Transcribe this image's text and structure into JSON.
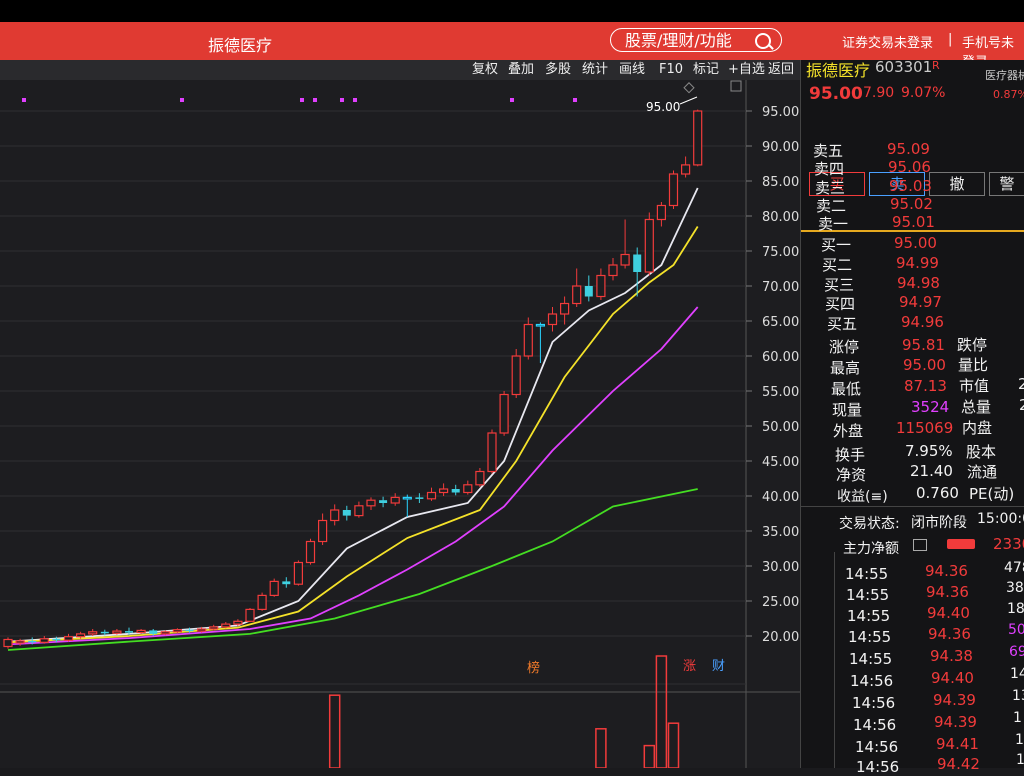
{
  "header": {
    "title": "振德医疗",
    "search_label": "股票/理财/功能",
    "login_status": "证券交易未登录",
    "phone_status": "手机号未登录"
  },
  "toolbar": [
    "复权",
    "叠加",
    "多股",
    "统计",
    "画线",
    "F10",
    "标记",
    "+自选",
    "返回"
  ],
  "stock": {
    "name": "振德医疗",
    "code": "603301",
    "r_flag": "R",
    "price": "95.00",
    "change": "7.90",
    "pct": "9.07%",
    "sector": "医疗器械",
    "sector_pct": "0.87%"
  },
  "trade_buttons": [
    "买",
    "卖",
    "撤",
    "警"
  ],
  "orderbook": {
    "asks": [
      {
        "label": "卖五",
        "price": "95.09"
      },
      {
        "label": "卖四",
        "price": "95.06"
      },
      {
        "label": "卖三",
        "price": "95.03"
      },
      {
        "label": "卖二",
        "price": "95.02"
      },
      {
        "label": "卖一",
        "price": "95.01"
      }
    ],
    "bids": [
      {
        "label": "买一",
        "price": "95.00"
      },
      {
        "label": "买二",
        "price": "94.99"
      },
      {
        "label": "买三",
        "price": "94.98"
      },
      {
        "label": "买四",
        "price": "94.97"
      },
      {
        "label": "买五",
        "price": "94.96"
      }
    ]
  },
  "stats": {
    "zhangting": {
      "label": "涨停",
      "value": "95.81"
    },
    "dieting": {
      "label": "跌停"
    },
    "zuigao": {
      "label": "最高",
      "value": "95.00"
    },
    "liangbi": {
      "label": "量比"
    },
    "zuidi": {
      "label": "最低",
      "value": "87.13"
    },
    "shizhi": {
      "label": "市值",
      "value": "2"
    },
    "xianliang": {
      "label": "现量",
      "value": "3524"
    },
    "zongliang": {
      "label": "总量",
      "value": "2"
    },
    "waipan": {
      "label": "外盘",
      "value": "115069"
    },
    "neipan": {
      "label": "内盘"
    },
    "huanshou": {
      "label": "换手",
      "value": "7.95%"
    },
    "guben": {
      "label": "股本"
    },
    "jingzi": {
      "label": "净资",
      "value": "21.40"
    },
    "liutong": {
      "label": "流通"
    },
    "shouyi": {
      "label": "收益(≡)",
      "value": "0.760"
    },
    "pe": {
      "label": "PE(动)"
    }
  },
  "status": {
    "label": "交易状态:",
    "value": "闭市阶段",
    "time": "15:00:0"
  },
  "fund_flow": {
    "label": "主力净额",
    "value": "2330"
  },
  "ticks": [
    {
      "time": "14:55",
      "price": "94.36",
      "vol": "478"
    },
    {
      "time": "14:55",
      "price": "94.36",
      "vol": "38"
    },
    {
      "time": "14:55",
      "price": "94.40",
      "vol": "18"
    },
    {
      "time": "14:55",
      "price": "94.36",
      "vol": "50"
    },
    {
      "time": "14:55",
      "price": "94.38",
      "vol": "69"
    },
    {
      "time": "14:56",
      "price": "94.40",
      "vol": "14"
    },
    {
      "time": "14:56",
      "price": "94.39",
      "vol": "13"
    },
    {
      "time": "14:56",
      "price": "94.39",
      "vol": "1"
    },
    {
      "time": "14:56",
      "price": "94.41",
      "vol": "1"
    },
    {
      "time": "14:56",
      "price": "94.42",
      "vol": "1"
    }
  ],
  "markers": {
    "bang": "榜",
    "zhang": "涨",
    "cai": "财"
  },
  "chart_data": {
    "type": "candlestick",
    "ylim": [
      17,
      97
    ],
    "y_ticks": [
      "95.00",
      "90.00",
      "85.00",
      "80.00",
      "75.00",
      "70.00",
      "65.00",
      "60.00",
      "55.00",
      "50.00",
      "45.00",
      "40.00",
      "35.00",
      "30.00",
      "25.00",
      "20.00"
    ],
    "price_annotation": "95.00",
    "candles": [
      [
        18.5,
        19.5,
        18.2,
        19.8
      ],
      [
        19,
        19.3,
        18.6,
        19.6
      ],
      [
        19.3,
        19.1,
        18.8,
        19.8
      ],
      [
        19.1,
        19.6,
        18.9,
        20
      ],
      [
        19.6,
        19.4,
        19.1,
        19.9
      ],
      [
        19.4,
        19.9,
        19.2,
        20.3
      ],
      [
        19.9,
        20.3,
        19.6,
        20.6
      ],
      [
        20.3,
        20.6,
        20,
        21
      ],
      [
        20.6,
        20.4,
        20.1,
        20.9
      ],
      [
        20.4,
        20.7,
        20.2,
        21
      ],
      [
        20.7,
        20.5,
        20.2,
        21.2
      ],
      [
        20.5,
        20.8,
        20.3,
        21
      ],
      [
        20.8,
        20.3,
        20,
        21
      ],
      [
        20.3,
        20.6,
        20.1,
        20.8
      ],
      [
        20.6,
        20.9,
        20.4,
        21.1
      ],
      [
        20.9,
        20.7,
        20.5,
        21.2
      ],
      [
        20.7,
        21,
        20.5,
        21.3
      ],
      [
        21,
        21.3,
        20.8,
        21.6
      ],
      [
        21.3,
        21.7,
        21.1,
        22
      ],
      [
        21.7,
        22.1,
        21.4,
        22.4
      ],
      [
        22.1,
        23.8,
        22,
        24
      ],
      [
        23.8,
        25.8,
        23.6,
        26.2
      ],
      [
        25.8,
        27.8,
        25.6,
        28.2
      ],
      [
        27.8,
        27.4,
        26.9,
        28.4
      ],
      [
        27.4,
        30.5,
        27.2,
        30.8
      ],
      [
        30.5,
        33.5,
        30.2,
        33.9
      ],
      [
        33.5,
        36.5,
        33,
        37.5
      ],
      [
        36.5,
        38,
        35.8,
        38.8
      ],
      [
        38,
        37.2,
        36.5,
        38.6
      ],
      [
        37.2,
        38.6,
        36.9,
        39.2
      ],
      [
        38.6,
        39.4,
        38,
        39.8
      ],
      [
        39.4,
        39,
        38.4,
        39.9
      ],
      [
        39,
        39.8,
        38.6,
        40.4
      ],
      [
        39.8,
        39.8,
        37,
        40.2
      ],
      [
        39.8,
        39.6,
        39,
        40.4
      ],
      [
        39.6,
        40.5,
        39.3,
        41.2
      ],
      [
        40.5,
        41,
        40,
        41.8
      ],
      [
        41,
        40.5,
        40.1,
        41.6
      ],
      [
        40.5,
        41.6,
        40.2,
        42.2
      ],
      [
        41.6,
        43.5,
        41.3,
        44
      ],
      [
        43.5,
        49,
        43.2,
        49.5
      ],
      [
        49,
        54.5,
        48.6,
        55
      ],
      [
        54.5,
        60,
        54,
        61
      ],
      [
        60,
        64.5,
        59.5,
        65.5
      ],
      [
        64.5,
        64.5,
        59,
        64.8
      ],
      [
        64.5,
        66,
        63.5,
        67
      ],
      [
        66,
        67.5,
        64.5,
        68.5
      ],
      [
        67.5,
        70,
        67,
        72.5
      ],
      [
        70,
        68.5,
        67.8,
        71.5
      ],
      [
        68.5,
        71.5,
        68,
        72.5
      ],
      [
        71.5,
        73,
        70.8,
        74
      ],
      [
        73,
        74.5,
        72.5,
        79.5
      ],
      [
        74.5,
        72,
        68.5,
        75.5
      ],
      [
        72,
        79.5,
        71.5,
        80.5
      ],
      [
        79.5,
        81.5,
        78.5,
        82
      ],
      [
        81.5,
        86,
        81,
        86.5
      ],
      [
        86,
        87.3,
        85.5,
        88.5
      ],
      [
        87.3,
        95,
        87.1,
        95.2
      ]
    ],
    "series": [
      {
        "name": "MA5",
        "color": "#e8e8f0",
        "points": [
          [
            0,
            19.2
          ],
          [
            10,
            20.3
          ],
          [
            19,
            21.5
          ],
          [
            24,
            25
          ],
          [
            28,
            32.5
          ],
          [
            33,
            37
          ],
          [
            38,
            39
          ],
          [
            41,
            45
          ],
          [
            45,
            62
          ],
          [
            48,
            66.5
          ],
          [
            51,
            69
          ],
          [
            54,
            73
          ],
          [
            57,
            84
          ]
        ]
      },
      {
        "name": "MA10",
        "color": "#f4e22a",
        "points": [
          [
            0,
            19.1
          ],
          [
            10,
            20
          ],
          [
            19,
            21.2
          ],
          [
            24,
            23.5
          ],
          [
            28,
            28.5
          ],
          [
            33,
            34
          ],
          [
            36,
            36
          ],
          [
            39,
            38
          ],
          [
            42,
            45
          ],
          [
            46,
            57
          ],
          [
            50,
            66
          ],
          [
            53,
            70.5
          ],
          [
            55,
            73
          ],
          [
            57,
            78.5
          ]
        ]
      },
      {
        "name": "MA20",
        "color": "#e040ff",
        "points": [
          [
            0,
            18.8
          ],
          [
            10,
            19.7
          ],
          [
            20,
            21
          ],
          [
            25,
            22.5
          ],
          [
            29,
            25.8
          ],
          [
            33,
            29.5
          ],
          [
            37,
            33.5
          ],
          [
            41,
            38.5
          ],
          [
            45,
            46.5
          ],
          [
            50,
            55
          ],
          [
            54,
            61
          ],
          [
            57,
            67
          ]
        ]
      },
      {
        "name": "MA60",
        "color": "#44dd22",
        "points": [
          [
            0,
            18
          ],
          [
            10,
            19.2
          ],
          [
            20,
            20.3
          ],
          [
            27,
            22.5
          ],
          [
            34,
            26
          ],
          [
            40,
            30
          ],
          [
            45,
            33.5
          ],
          [
            50,
            38.5
          ],
          [
            57,
            41
          ]
        ]
      }
    ],
    "volume_y_tick": "30000",
    "volume_bars": [
      [
        27,
        26
      ],
      [
        49,
        14
      ],
      [
        53,
        8
      ],
      [
        54,
        40
      ],
      [
        55,
        16
      ]
    ]
  }
}
